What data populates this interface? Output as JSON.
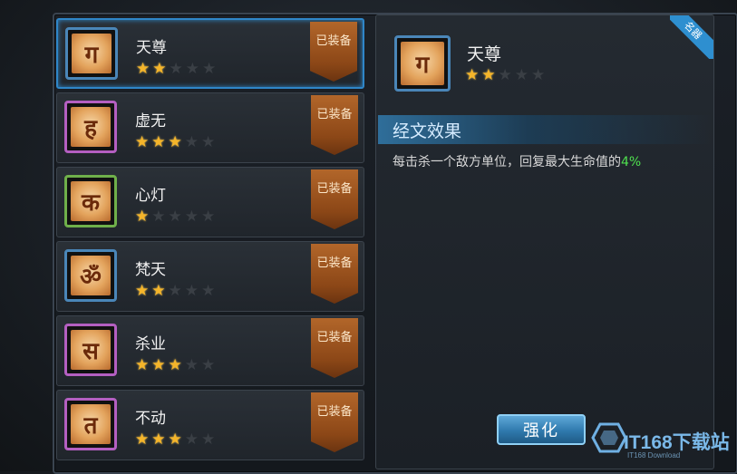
{
  "scripture_list": {
    "items": [
      {
        "name": "天尊",
        "stars": 2,
        "max_stars": 5,
        "status": "已装备",
        "glyph": "ग",
        "frame": "blue",
        "selected": true
      },
      {
        "name": "虚无",
        "stars": 3,
        "max_stars": 5,
        "status": "已装备",
        "glyph": "ह",
        "frame": "purple",
        "selected": false
      },
      {
        "name": "心灯",
        "stars": 1,
        "max_stars": 5,
        "status": "已装备",
        "glyph": "क",
        "frame": "green",
        "selected": false
      },
      {
        "name": "梵天",
        "stars": 2,
        "max_stars": 5,
        "status": "已装备",
        "glyph": "ॐ",
        "frame": "blue",
        "selected": false
      },
      {
        "name": "杀业",
        "stars": 3,
        "max_stars": 5,
        "status": "已装备",
        "glyph": "स",
        "frame": "purple",
        "selected": false
      },
      {
        "name": "不动",
        "stars": 3,
        "max_stars": 5,
        "status": "已装备",
        "glyph": "त",
        "frame": "purple",
        "selected": false
      }
    ]
  },
  "detail": {
    "name": "天尊",
    "stars": 2,
    "max_stars": 5,
    "glyph": "ग",
    "corner_tag": "名器",
    "effect_title": "经文效果",
    "effect_desc_prefix": "每击杀一个敌方单位，回复最大生命值的",
    "effect_desc_value": "4%",
    "upgrade_button": "强化"
  },
  "watermark": {
    "main": "IT168下载站",
    "sub": "IT168 Download"
  },
  "colors": {
    "star_on": "#f5b52a",
    "star_off": "#3a3f45",
    "frame_blue": "#4a86b8",
    "frame_purple": "#b45fc1",
    "frame_green": "#6fb04a",
    "highlight_green": "#4fe04f",
    "selected_border": "#2f86c8"
  }
}
